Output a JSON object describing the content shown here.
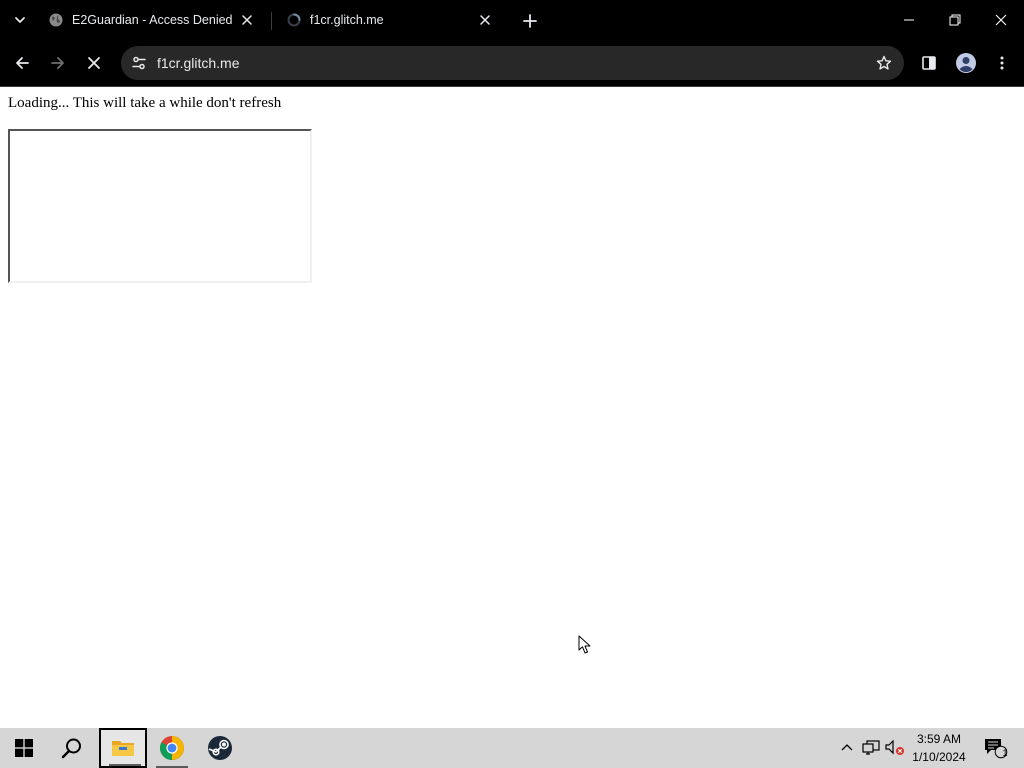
{
  "browser": {
    "tabs": [
      {
        "title": "E2Guardian - Access Denied",
        "favicon": "globe-icon",
        "active": false
      },
      {
        "title": "f1cr.glitch.me",
        "favicon": "loading-spinner-icon",
        "active": true
      }
    ],
    "address_bar": {
      "url": "f1cr.glitch.me"
    },
    "accent": "#000000"
  },
  "page": {
    "loading_message": "Loading... This will take a while don't refresh"
  },
  "taskbar": {
    "apps": [
      "start-icon",
      "search-icon",
      "file-explorer-icon",
      "chrome-icon",
      "steam-icon"
    ],
    "clock": {
      "time": "3:59 AM",
      "date": "1/10/2024"
    },
    "notification_count": "1"
  }
}
